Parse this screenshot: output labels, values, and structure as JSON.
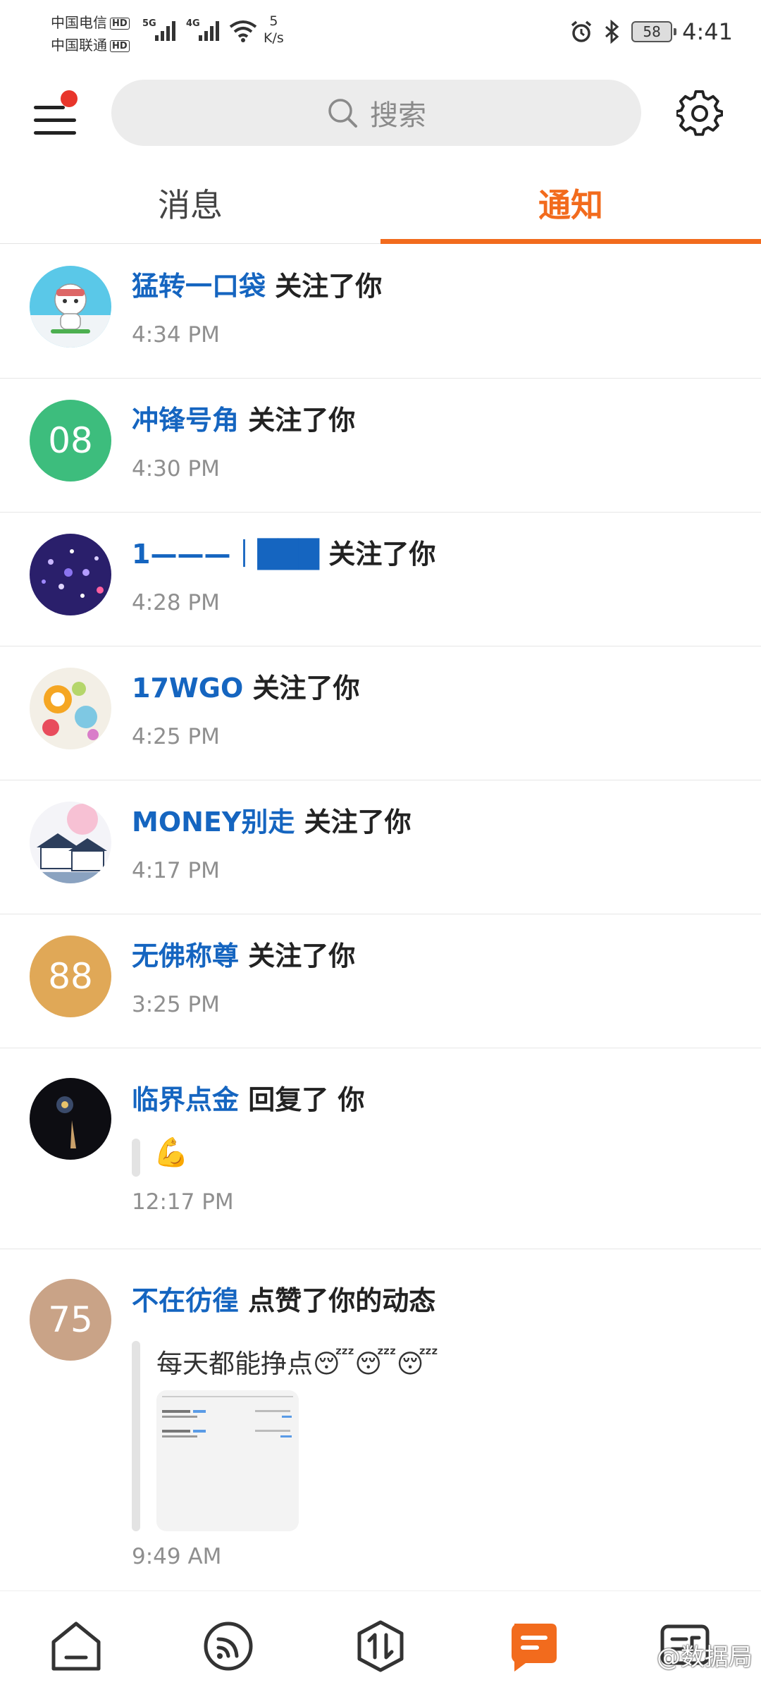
{
  "status_bar": {
    "carrier1": "中国电信",
    "carrier2": "中国联通",
    "hd": "HD",
    "sig1": "5G",
    "sig2": "4G",
    "net_speed_value": "5",
    "net_speed_unit": "K/s",
    "battery": "58",
    "time": "4:41"
  },
  "header": {
    "search_placeholder": "搜索"
  },
  "tabs": [
    {
      "label": "消息",
      "active": false
    },
    {
      "label": "通知",
      "active": true
    }
  ],
  "notifications": [
    {
      "user": "猛转一口袋",
      "action": "关注了你",
      "time": "4:34 PM",
      "avatar_text": ""
    },
    {
      "user": "冲锋号角",
      "action": "关注了你",
      "time": "4:30 PM",
      "avatar_text": "08",
      "avatar_color": "#3dbd7d"
    },
    {
      "user": "1———｜███",
      "action": "关注了你",
      "time": "4:28 PM",
      "avatar_text": ""
    },
    {
      "user": "17WGO",
      "action": "关注了你",
      "time": "4:25 PM",
      "avatar_text": ""
    },
    {
      "user": "MONEY别走",
      "action": "关注了你",
      "time": "4:17 PM",
      "avatar_text": ""
    },
    {
      "user": "无佛称尊",
      "action": "关注了你",
      "time": "3:25 PM",
      "avatar_text": "88",
      "avatar_color": "#e0a857"
    },
    {
      "user": "临界点金",
      "action": "回复了 你",
      "time": "12:17 PM",
      "avatar_text": "",
      "reply": "💪"
    },
    {
      "user": "不在彷徨",
      "action": "点赞了你的动态",
      "time": "9:49 AM",
      "avatar_text": "75",
      "avatar_color": "#c9a387",
      "post_text": "每天都能挣点😴😴😴"
    }
  ],
  "bottom_nav": {
    "items": [
      "home-icon",
      "feed-icon",
      "trade-icon",
      "messages-icon",
      "profile-icon"
    ],
    "active": "messages-icon",
    "watermark": "@数据局"
  },
  "colors": {
    "accent": "#f26b1d",
    "username": "#1565c0",
    "badge": "#e8352b"
  }
}
